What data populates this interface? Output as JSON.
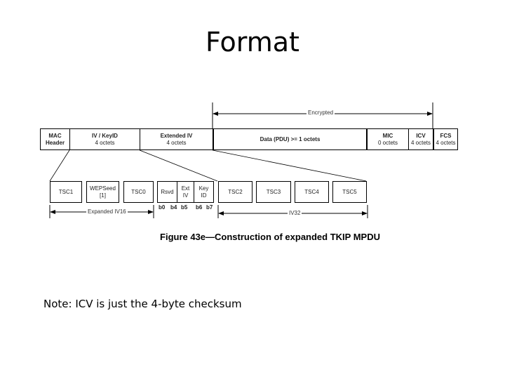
{
  "slide": {
    "title": "Format",
    "note": "Note: ICV is just the 4-byte checksum"
  },
  "diagram": {
    "encrypted_label": "Encrypted",
    "top_row": [
      {
        "name": "MAC",
        "sub": "Header"
      },
      {
        "name": "IV / KeyID",
        "sub": "4 octets"
      },
      {
        "name": "Extended IV",
        "sub": "4 octets"
      },
      {
        "name": "Data (PDU) >= 1 octets",
        "sub": ""
      },
      {
        "name": "MIC",
        "sub": "0 octets"
      },
      {
        "name": "ICV",
        "sub": "4 octets"
      },
      {
        "name": "FCS",
        "sub": "4 octets"
      }
    ],
    "bottom_row": [
      {
        "name": "TSC1",
        "sub": ""
      },
      {
        "name": "WEPSeed",
        "sub": "[1]"
      },
      {
        "name": "TSC0",
        "sub": ""
      },
      {
        "name": "Rsvd",
        "sub": ""
      },
      {
        "name": "Ext",
        "sub": "IV"
      },
      {
        "name": "Key",
        "sub": "ID"
      },
      {
        "name": "TSC2",
        "sub": ""
      },
      {
        "name": "TSC3",
        "sub": ""
      },
      {
        "name": "TSC4",
        "sub": ""
      },
      {
        "name": "TSC5",
        "sub": ""
      }
    ],
    "bit_labels": {
      "b0": "b0",
      "b4": "b4",
      "b5": "b5",
      "b6": "b6",
      "b7": "b7"
    },
    "span_iv16": "Expanded IV16",
    "span_iv32": "IV32",
    "caption": "Figure 43e—Construction of expanded TKIP MPDU"
  }
}
